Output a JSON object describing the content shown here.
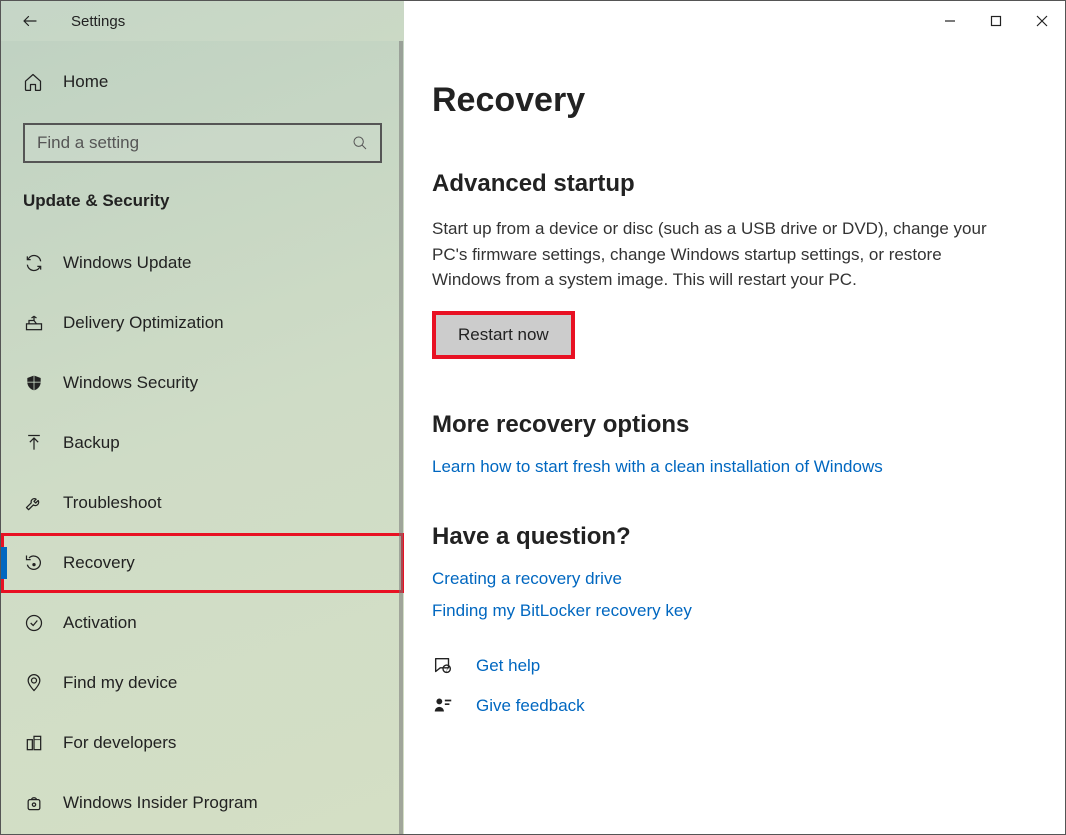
{
  "window": {
    "title": "Settings"
  },
  "search": {
    "placeholder": "Find a setting"
  },
  "home": {
    "label": "Home"
  },
  "category": "Update & Security",
  "sidebar": {
    "items": [
      {
        "label": "Windows Update",
        "icon": "sync-icon",
        "selected": false,
        "highlighted": false
      },
      {
        "label": "Delivery Optimization",
        "icon": "delivery-icon",
        "selected": false,
        "highlighted": false
      },
      {
        "label": "Windows Security",
        "icon": "shield-icon",
        "selected": false,
        "highlighted": false
      },
      {
        "label": "Backup",
        "icon": "backup-icon",
        "selected": false,
        "highlighted": false
      },
      {
        "label": "Troubleshoot",
        "icon": "wrench-icon",
        "selected": false,
        "highlighted": false
      },
      {
        "label": "Recovery",
        "icon": "recovery-icon",
        "selected": true,
        "highlighted": true
      },
      {
        "label": "Activation",
        "icon": "check-circle-icon",
        "selected": false,
        "highlighted": false
      },
      {
        "label": "Find my device",
        "icon": "location-icon",
        "selected": false,
        "highlighted": false
      },
      {
        "label": "For developers",
        "icon": "developers-icon",
        "selected": false,
        "highlighted": false
      },
      {
        "label": "Windows Insider Program",
        "icon": "insider-icon",
        "selected": false,
        "highlighted": false
      }
    ]
  },
  "main": {
    "title": "Recovery",
    "advanced": {
      "heading": "Advanced startup",
      "desc": "Start up from a device or disc (such as a USB drive or DVD), change your PC's firmware settings, change Windows startup settings, or restore Windows from a system image. This will restart your PC.",
      "button": "Restart now"
    },
    "more": {
      "heading": "More recovery options",
      "link": "Learn how to start fresh with a clean installation of Windows"
    },
    "question": {
      "heading": "Have a question?",
      "links": [
        "Creating a recovery drive",
        "Finding my BitLocker recovery key"
      ]
    },
    "help": {
      "label": "Get help"
    },
    "feedback": {
      "label": "Give feedback"
    }
  },
  "highlight_color": "#e81123"
}
